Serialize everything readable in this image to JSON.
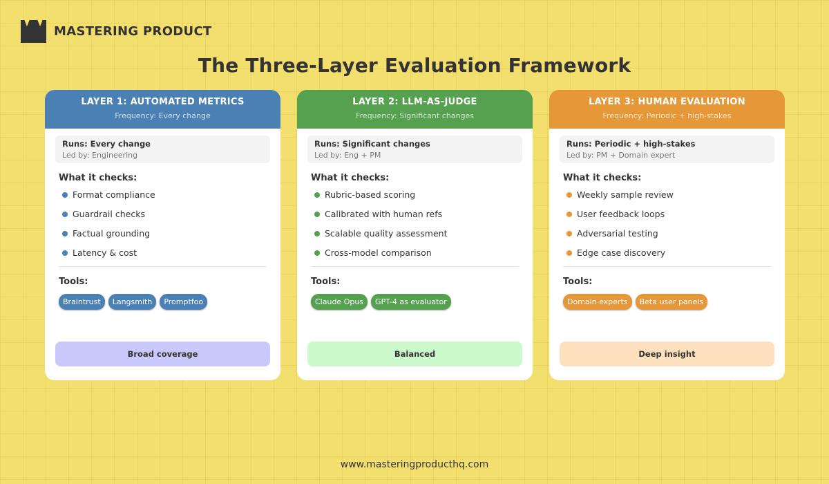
{
  "brand": {
    "name": "MASTERING PRODUCT",
    "icon": "crown-logo-icon"
  },
  "title": "The Three-Layer Evaluation Framework",
  "labels": {
    "checks_heading": "What it checks:",
    "tools_heading": "Tools:"
  },
  "layers": [
    {
      "title": "LAYER 1: AUTOMATED METRICS",
      "frequency": "Frequency: Every change",
      "runs": "Runs: Every change",
      "led_by": "Led by: Engineering",
      "checks": [
        "Format compliance",
        "Guardrail checks",
        "Factual grounding",
        "Latency & cost"
      ],
      "tools": [
        "Braintrust",
        "Langsmith",
        "Promptfoo"
      ],
      "footer": "Broad coverage",
      "color": "#4a80b4",
      "footer_color": "#c9c8fa"
    },
    {
      "title": "LAYER 2: LLM-AS-JUDGE",
      "frequency": "Frequency: Significant changes",
      "runs": "Runs: Significant changes",
      "led_by": "Led by: Eng + PM",
      "checks": [
        "Rubric-based scoring",
        "Calibrated with human refs",
        "Scalable quality assessment",
        "Cross-model comparison"
      ],
      "tools": [
        "Claude Opus",
        "GPT-4 as evaluator"
      ],
      "footer": "Balanced",
      "color": "#55a150",
      "footer_color": "#ccf9cb"
    },
    {
      "title": "LAYER 3: HUMAN EVALUATION",
      "frequency": "Frequency: Periodic + high-stakes",
      "runs": "Runs: Periodic + high-stakes",
      "led_by": "Led by: PM + Domain expert",
      "checks": [
        "Weekly sample review",
        "User feedback loops",
        "Adversarial testing",
        "Edge case discovery"
      ],
      "tools": [
        "Domain experts",
        "Beta user panels"
      ],
      "footer": "Deep insight",
      "color": "#e69738",
      "footer_color": "#fde0bd"
    }
  ],
  "footer_url": "www.masteringproducthq.com"
}
